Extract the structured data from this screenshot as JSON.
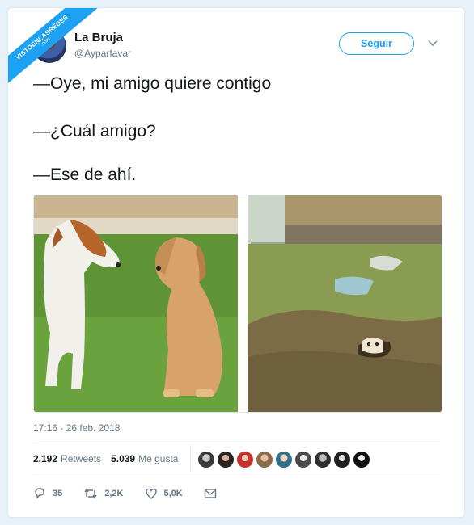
{
  "watermark": {
    "text": "VISTOENLASREDES",
    "sub": ".com"
  },
  "user": {
    "name": "La Bruja",
    "handle": "@Ayparfavar"
  },
  "follow_label": "Seguir",
  "tweet": {
    "lines": [
      "—Oye, mi amigo quiere contigo",
      "—¿Cuál amigo?",
      "—Ese de ahí."
    ]
  },
  "timestamp": "17:16 - 26 feb. 2018",
  "stats": {
    "retweets_count": "2.192",
    "retweets_label": "Retweets",
    "likes_count": "5.039",
    "likes_label": "Me gusta"
  },
  "actions": {
    "replies": "35",
    "retweets": "2,2K",
    "likes": "5,0K"
  },
  "icons": [
    "chevron-down-icon",
    "reply-icon",
    "retweet-icon",
    "heart-icon",
    "message-icon"
  ],
  "colors": {
    "accent": "#1da1f2",
    "text": "#14171a",
    "muted": "#657786",
    "background": "#e7f1f9"
  }
}
